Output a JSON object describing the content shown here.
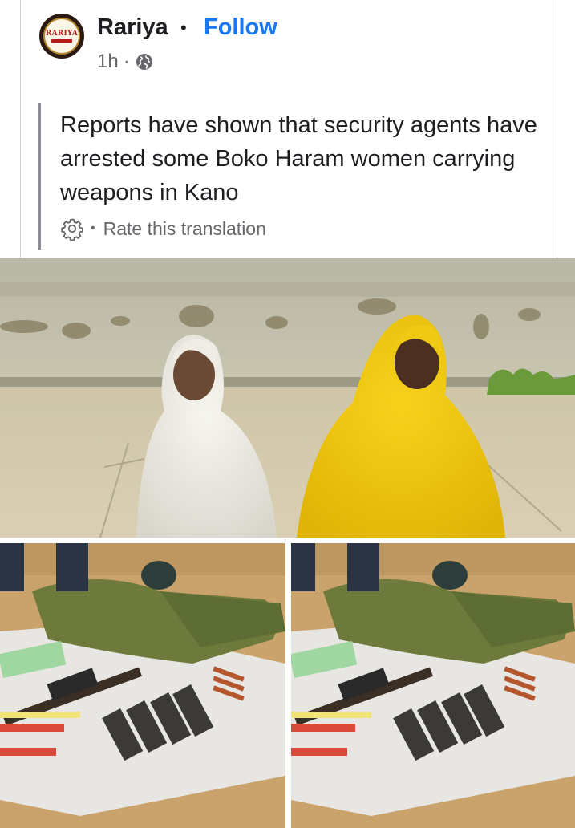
{
  "post": {
    "author": "Rariya",
    "separator": "•",
    "follow_label": "Follow",
    "time": "1h",
    "meta_separator": "·",
    "privacy_icon": "globe-icon",
    "text": "Reports have shown that security agents have arrested some Boko Haram women carrying weapons in Kano",
    "translation": {
      "settings_icon": "gear-icon",
      "separator": "•",
      "rate_label": "Rate this translation"
    },
    "avatar": {
      "logo_text": "RARIYA"
    }
  },
  "colors": {
    "follow": "#1877f2",
    "text": "#1c1e21",
    "secondary": "#65676b"
  }
}
